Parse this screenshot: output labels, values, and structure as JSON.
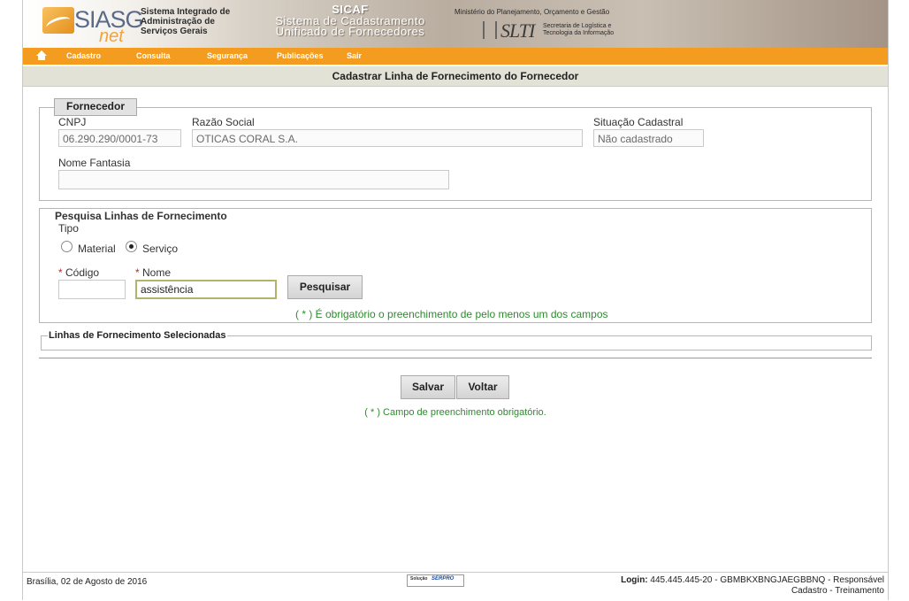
{
  "header": {
    "logo_text": "SIASG",
    "logo_net": "net",
    "system_title_1": "Sistema Integrado de",
    "system_title_2": "Administração de",
    "system_title_3": "Serviços Gerais",
    "sicaf_title": "SICAF",
    "sicaf_sub_1": "Sistema de Cadastramento",
    "sicaf_sub_2": "Unificado de Fornecedores",
    "ministry": "Ministério do Planejamento, Orçamento e Gestão",
    "slti": "SLTI",
    "slti_desc_1": "Secretaria de Logística e",
    "slti_desc_2": "Tecnologia da Informação"
  },
  "nav": {
    "items": [
      "Cadastro",
      "Consulta",
      "Segurança",
      "Publicações",
      "Sair"
    ]
  },
  "page": {
    "title": "Cadastrar Linha de Fornecimento do Fornecedor"
  },
  "fornecedor": {
    "legend": "Fornecedor",
    "cnpj_label": "CNPJ",
    "cnpj_value": "06.290.290/0001-73",
    "razao_label": "Razão Social",
    "razao_value": "OTICAS CORAL S.A.",
    "situacao_label": "Situação Cadastral",
    "situacao_value": "Não cadastrado",
    "fantasia_label": "Nome Fantasia",
    "fantasia_value": ""
  },
  "pesquisa": {
    "legend": "Pesquisa Linhas de Fornecimento",
    "tipo_label": "Tipo",
    "radio_material": "Material",
    "radio_servico": "Serviço",
    "selected_tipo": "Serviço",
    "req_mark": "*",
    "codigo_label": "Código",
    "codigo_value": "",
    "nome_label": "Nome",
    "nome_value": "assistência",
    "search_button": "Pesquisar",
    "hint": "( * ) É obrigatório o preenchimento de pelo menos um dos campos"
  },
  "selecionadas": {
    "legend": "Linhas de Fornecimento Selecionadas"
  },
  "actions": {
    "save_button": "Salvar",
    "back_button": "Voltar",
    "hint": "( * ) Campo de preenchimento obrigatório."
  },
  "footer": {
    "date": "Brasília, 02 de Agosto de 2016",
    "logo_solucao": "Solução",
    "logo_serpro": "SERPRO",
    "login_label": "Login:",
    "login_value": "445.445.445-20 - GBMBKXBNGJAEGBBNQ - Responsável",
    "login_line2": "Cadastro - Treinamento"
  },
  "colors": {
    "nav_orange": "#f39c1f",
    "title_bar": "#e3e2d6",
    "hint_green": "#2e8b2e",
    "required_red": "#cc2222"
  }
}
